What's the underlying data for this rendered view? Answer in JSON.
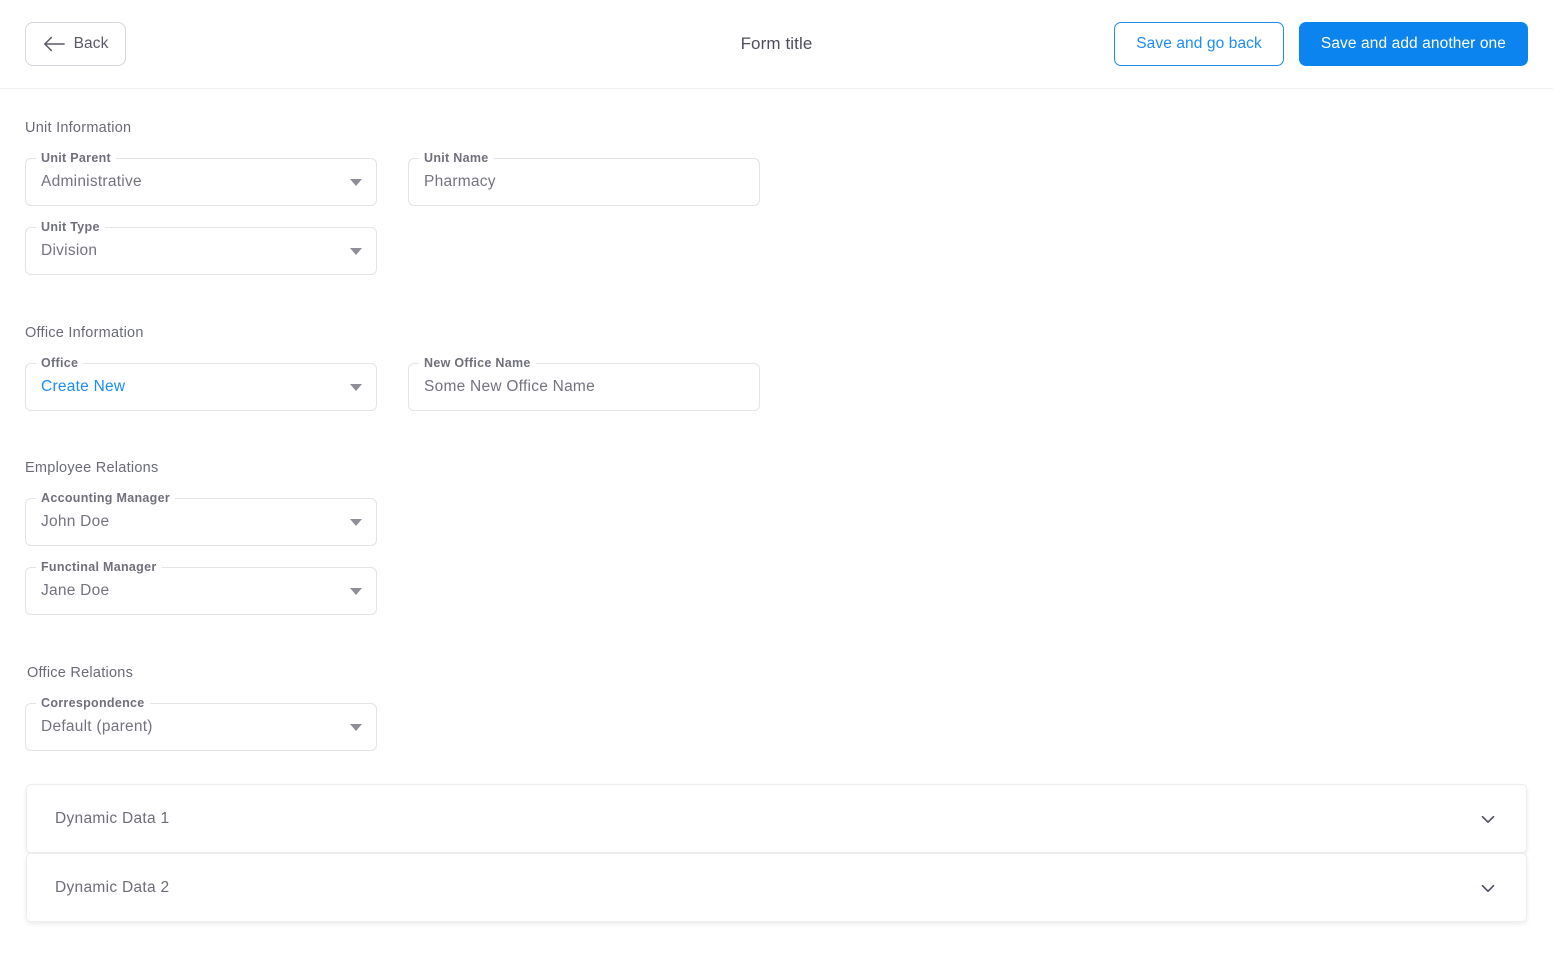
{
  "header": {
    "back_label": "Back",
    "back_icon": "arrow-left-icon",
    "title": "Form title",
    "save_go_back_label": "Save and go back",
    "save_add_another_label": "Save and add another one",
    "primary_color": "#0b84ef",
    "outline_color": "#1c8cf5"
  },
  "sections": [
    {
      "title": "Unit Information",
      "fields": [
        {
          "label": "Unit Parent",
          "value": "Administrative",
          "type": "select",
          "icon": "caret-down-icon"
        },
        {
          "label": "Unit Name",
          "value": "Pharmacy",
          "type": "text",
          "placeholder": "Unit Name"
        },
        {
          "label": "Unit Type",
          "value": "Division",
          "type": "select",
          "icon": "caret-down-icon"
        }
      ]
    },
    {
      "title": "Office Information",
      "fields": [
        {
          "label": "Office",
          "value": "Create New",
          "type": "select",
          "icon": "caret-down-icon",
          "accent": true
        },
        {
          "label": "New Office Name",
          "value": "Some New Office Name",
          "type": "text",
          "placeholder": "Some New Office Name"
        }
      ]
    },
    {
      "title": "Employee Relations",
      "fields": [
        {
          "label": "Accounting Manager",
          "value": "John Doe",
          "type": "select",
          "icon": "caret-down-icon"
        },
        {
          "label": "Functinal Manager",
          "value": "Jane Doe",
          "type": "select",
          "icon": "caret-down-icon"
        }
      ]
    },
    {
      "title": "Office Relations",
      "fields": [
        {
          "label": "Correspondence",
          "value": "Default (parent)",
          "type": "select",
          "icon": "caret-down-icon"
        }
      ]
    }
  ],
  "panels": [
    {
      "label": "Dynamic Data 1",
      "icon": "chevron-down-icon",
      "expanded": false
    },
    {
      "label": "Dynamic Data 2",
      "icon": "chevron-down-icon",
      "expanded": false
    }
  ]
}
